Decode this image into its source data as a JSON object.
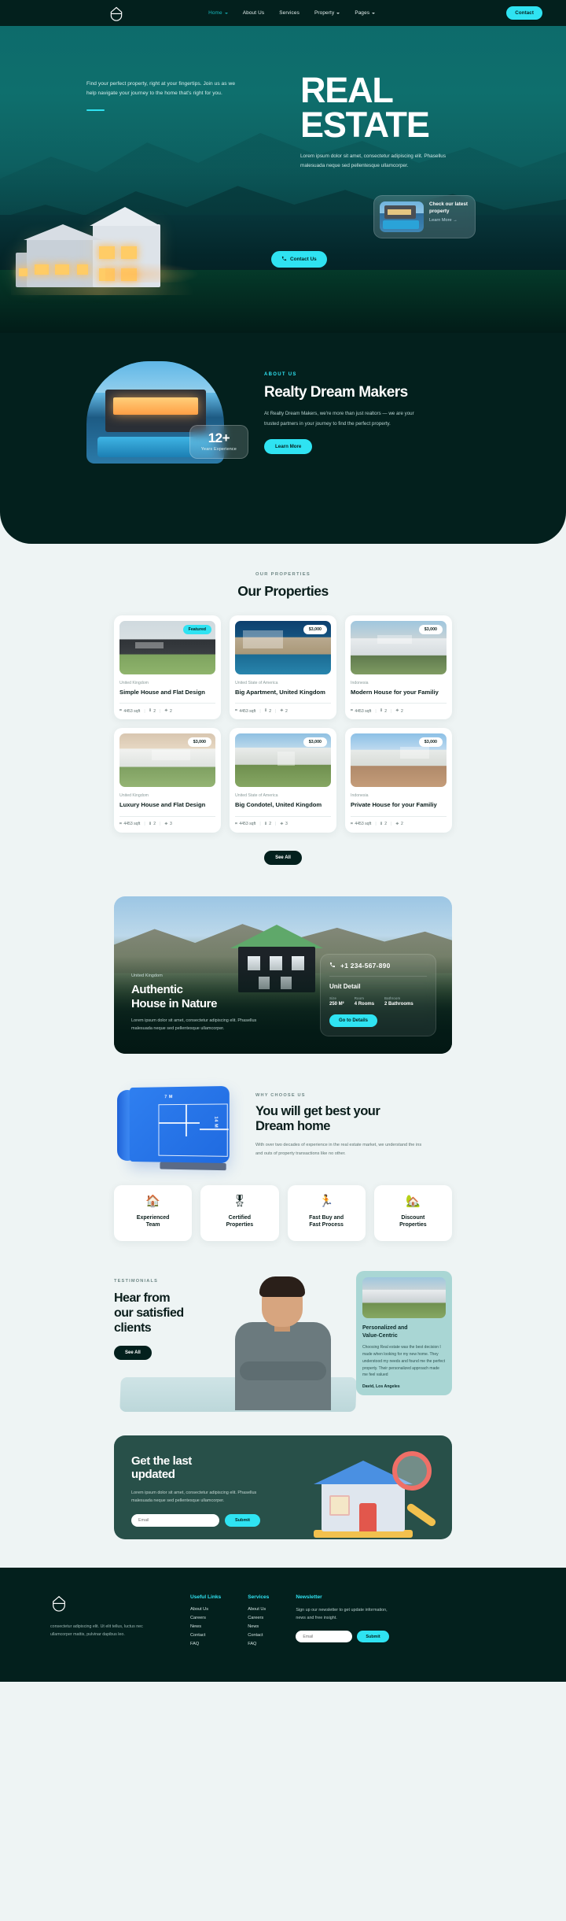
{
  "nav": {
    "logo_icon": "house-logo-icon",
    "items": [
      {
        "label": "Home",
        "has_caret": true,
        "active": true
      },
      {
        "label": "About Us",
        "has_caret": false,
        "active": false
      },
      {
        "label": "Services",
        "has_caret": false,
        "active": false
      },
      {
        "label": "Property",
        "has_caret": true,
        "active": false
      },
      {
        "label": "Pages",
        "has_caret": true,
        "active": false
      }
    ],
    "cta_label": "Contact"
  },
  "hero": {
    "subtext": "Find your perfect property, right at your fingertips. Join us as we help navigate your journey to the home that's right for you.",
    "title_line1": "REAL",
    "title_line2": "ESTATE",
    "description": "Lorem ipsum dolor sit amet, consectetur adipiscing elit. Phasellus malesuada neque sed pellentesque ullamcorper.",
    "glass_card": {
      "title": "Check our latest property",
      "link": "Learn More →"
    },
    "contact_button": "Contact Us",
    "phone_icon": "phone-icon"
  },
  "about": {
    "eyebrow": "ABOUT US",
    "title": "Realty Dream Makers",
    "paragraph": "At Realty Dream Makers, we're more than just realtors — we are your trusted partners in your journey to find the perfect property.",
    "button": "Learn More",
    "badge_number": "12+",
    "badge_label": "Years Experience"
  },
  "properties": {
    "eyebrow": "OUR PROPERTIES",
    "title": "Our Properties",
    "see_all": "See All",
    "cards": [
      {
        "tag": "Featured",
        "tag_type": "featured",
        "location": "United Kingdom",
        "title": "Simple House and Flat Design",
        "sqft": "4453 sqft",
        "beds": "2",
        "baths": "2"
      },
      {
        "tag": "$3,000",
        "tag_type": "price",
        "location": "United State of America",
        "title": "Big Apartment, United Kingdom",
        "sqft": "4453 sqft",
        "beds": "2",
        "baths": "2"
      },
      {
        "tag": "$3,000",
        "tag_type": "price",
        "location": "Indonesia",
        "title": "Modern House for your Familiy",
        "sqft": "4453 sqft",
        "beds": "2",
        "baths": "2"
      },
      {
        "tag": "$3,000",
        "tag_type": "price",
        "location": "United Kingdom",
        "title": "Luxury House and Flat Design",
        "sqft": "4453 sqft",
        "beds": "2",
        "baths": "3"
      },
      {
        "tag": "$3,000",
        "tag_type": "price",
        "location": "United State of America",
        "title": "Big Condotel, United Kingdom",
        "sqft": "4453 sqft",
        "beds": "2",
        "baths": "3"
      },
      {
        "tag": "$3,000",
        "tag_type": "price",
        "location": "Indonesia",
        "title": "Private House for your Familiy",
        "sqft": "4453 sqft",
        "beds": "2",
        "baths": "2"
      }
    ]
  },
  "authentic": {
    "location": "United Kingdom",
    "title_line1": "Authentic",
    "title_line2": "House in Nature",
    "paragraph": "Lorem ipsum dolor sit amet, consectetur adipiscing elit. Phasellus malesuada neque sed pellentesque ullamcorper.",
    "phone": "+1 234-567-890",
    "unit_detail_title": "Unit Detail",
    "specs": [
      {
        "key": "Size",
        "value": "250 M²"
      },
      {
        "key": "Room",
        "value": "4 Rooms"
      },
      {
        "key": "Bathroom",
        "value": "2 Bathrooms"
      }
    ],
    "button": "Go to Details",
    "phone_icon": "phone-icon"
  },
  "why": {
    "eyebrow": "WHY CHOOSE US",
    "title_line1": "You will get best your",
    "title_line2": "Dream home",
    "paragraph": "With over two decades of experience in the real estate market, we understand the ins and outs of property transactions like no other.",
    "blueprint_width": "7 M",
    "blueprint_height": "14 M",
    "features": [
      {
        "icon": "house-with-person-icon",
        "glyph": "🏠",
        "label_line1": "Experienced",
        "label_line2": "Team"
      },
      {
        "icon": "certificate-icon",
        "glyph": "🎖",
        "label_line1": "Certified",
        "label_line2": "Properties"
      },
      {
        "icon": "fast-process-icon",
        "glyph": "🏃",
        "label_line1": "Fast Buy and",
        "label_line2": "Fast Process"
      },
      {
        "icon": "discount-house-icon",
        "glyph": "🏡",
        "label_line1": "Discount",
        "label_line2": "Properties"
      }
    ]
  },
  "testimonials": {
    "eyebrow": "TESTIMONIALS",
    "title_line1": "Hear from",
    "title_line2": "our satisfied",
    "title_line3": "clients",
    "button": "See All",
    "card": {
      "title_line1": "Personalized and",
      "title_line2": "Value-Centric",
      "quote": "Choosing Real estate was the best decision I made when looking for my new home. They understood my needs and found me the perfect property. Their personalized approach made me feel valued",
      "author": "David, Los Angeles"
    }
  },
  "newsletter": {
    "title_line1": "Get the last",
    "title_line2": "updated",
    "paragraph": "Lorem ipsum dolor sit amet, consectetur adipiscing elit. Phasellus malesuada neque sed pellentesque ullamcorper.",
    "email_placeholder": "Email",
    "submit": "Submit"
  },
  "footer": {
    "logo_icon": "house-logo-icon",
    "description": "consectetur adipiscing elit. Ut elit tellus, luctus nec ullamcorper mattis, pulvinar dapibus leo.",
    "columns": [
      {
        "heading": "Useful Links",
        "links": [
          "About Us",
          "Careers",
          "News",
          "Contact",
          "FAQ"
        ]
      },
      {
        "heading": "Services",
        "links": [
          "About Us",
          "Careers",
          "News",
          "Contact",
          "FAQ"
        ]
      }
    ],
    "newsletter": {
      "heading": "Newsletter",
      "text": "Sign up our newsletter to get update information, news and free insight.",
      "email_placeholder": "Email",
      "submit": "Submit"
    }
  },
  "colors": {
    "dark": "#03201d",
    "accent": "#2fe3f2",
    "page_bg": "#eef4f4",
    "teal_deep": "#285049"
  }
}
